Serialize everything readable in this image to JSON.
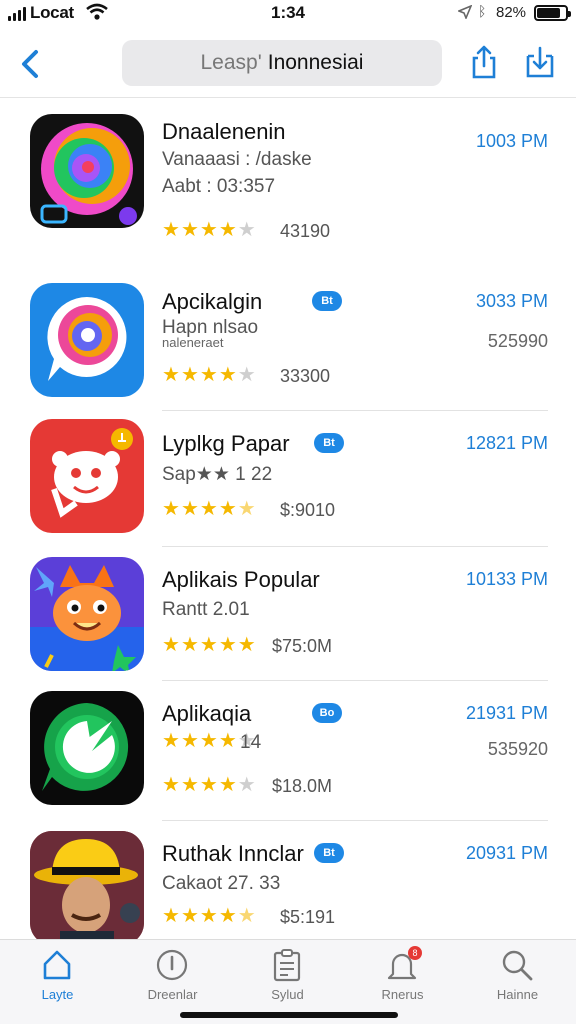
{
  "status_bar": {
    "carrier": "Locat",
    "time": "1:34",
    "battery": "82%",
    "battery_level": 0.82
  },
  "nav": {
    "search_dim": "Leasp'",
    "search_query": "Inonnesiai"
  },
  "colors": {
    "accent": "#1e7fd6",
    "star": "#f5b800",
    "badge": "#1e88e5"
  },
  "apps": [
    {
      "name": "Dnaalenenin",
      "subtitle": "Vanaaasi : /daske",
      "line2": "Aabt : 03:357",
      "time": "1003 PM",
      "value": "",
      "rating_count": "43190",
      "stars": 4,
      "badge": ""
    },
    {
      "name": "Apcikalgin",
      "subtitle": "Hapn nlsao",
      "line2": "naleneraet",
      "time": "3033 PM",
      "value": "525990",
      "rating_count": "33300",
      "stars": 4,
      "badge": "Bt"
    },
    {
      "name": "Lyplkg Papar",
      "subtitle": "Sap★★ 1 22",
      "line2": "",
      "time": "12821 PM",
      "value": "",
      "rating_count": "$:9010",
      "stars": 4.5,
      "badge": "Bt"
    },
    {
      "name": "Aplikais Popular",
      "subtitle": "Rantt 2.01",
      "line2": "",
      "time": "10133 PM",
      "value": "",
      "rating_count": "$75:0M",
      "stars": 5,
      "badge": ""
    },
    {
      "name": "Aplikaqia",
      "subtitle": "14",
      "line2": "",
      "time": "21931 PM",
      "value": "535920",
      "rating_count": "$18.0M",
      "stars": 4,
      "badge": "Bo"
    },
    {
      "name": "Ruthak Innclar",
      "subtitle": "Cakaot 27. 33",
      "line2": "",
      "time": "20931 PM",
      "value": "",
      "rating_count": "$5:191",
      "stars": 4.5,
      "badge": "Bt"
    }
  ],
  "tabs": [
    {
      "label": "Layte",
      "icon": "home-icon"
    },
    {
      "label": "Dreenlar",
      "icon": "compass-icon"
    },
    {
      "label": "Sylud",
      "icon": "clipboard-icon"
    },
    {
      "label": "Rnerus",
      "icon": "bell-icon",
      "badge": "8"
    },
    {
      "label": "Hainne",
      "icon": "search-icon"
    }
  ]
}
